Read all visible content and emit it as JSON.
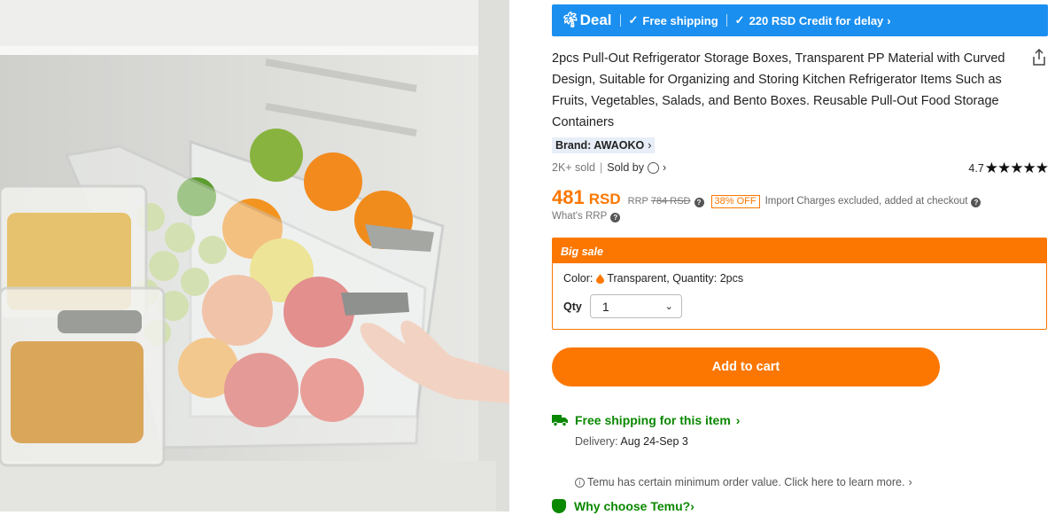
{
  "deal_bar": {
    "deal_label": "Deal",
    "free_shipping": "Free shipping",
    "credit": "220 RSD Credit for delay"
  },
  "product": {
    "title": "2pcs Pull-Out Refrigerator Storage Boxes, Transparent PP Material with Curved Design, Suitable for Organizing and Storing Kitchen Refrigerator Items Such as Fruits, Vegetables, Salads, and Bento Boxes. Reusable Pull-Out Food Storage Containers",
    "brand": "Brand: AWAOKO",
    "sold": "2K+ sold",
    "sold_by": "Sold by",
    "rating": "4.7",
    "stars": "★★★★★"
  },
  "price": {
    "amount": "481",
    "currency": "RSD",
    "rrp_label": "RRP",
    "rrp_value": "784 RSD",
    "discount": "38% OFF",
    "import_note": "Import Charges excluded, added at checkout",
    "whats_rrp": "What's RRP"
  },
  "sale": {
    "header": "Big sale",
    "color_label": "Color:",
    "color_value": "Transparent, Quantity: 2pcs",
    "qty_label": "Qty",
    "qty_value": "1"
  },
  "actions": {
    "add_to_cart": "Add to cart"
  },
  "shipping": {
    "free_shipping_item": "Free shipping for this item",
    "delivery_label": "Delivery:",
    "delivery_value": "Aug 24-Sep 3"
  },
  "notes": {
    "min_order": "Temu has certain minimum order value. Click here to learn more.",
    "why_choose": "Why choose Temu?"
  },
  "colors": {
    "accent": "#fb7701",
    "deal_blue": "#1a8ff0",
    "green": "#0a8800"
  },
  "icons": [
    "palm-icon",
    "check-icon",
    "chevron-right-icon",
    "share-icon",
    "question-icon",
    "drop-icon",
    "chevron-down-icon",
    "truck-icon",
    "info-icon",
    "shield-icon"
  ]
}
